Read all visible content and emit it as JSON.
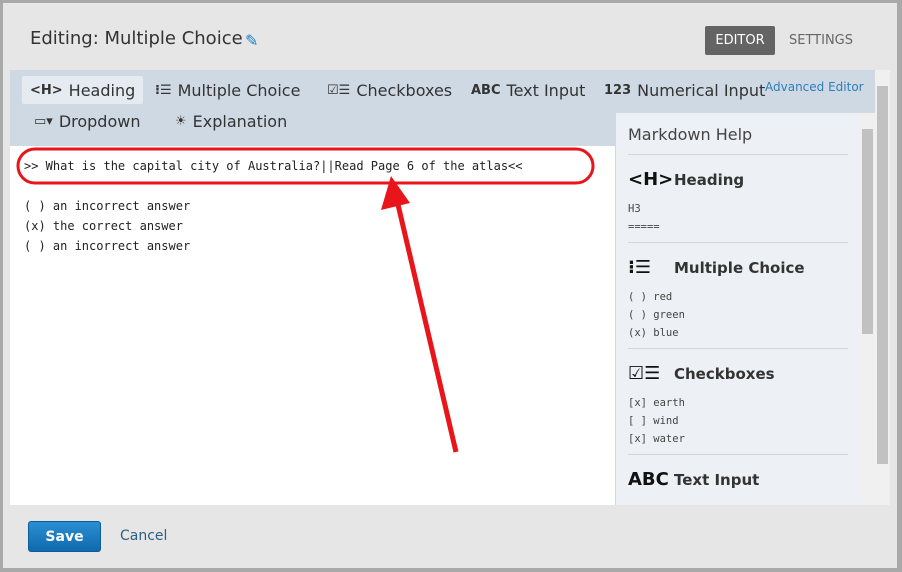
{
  "header": {
    "title": "Editing: Multiple Choice",
    "tabs": [
      {
        "label": "EDITOR",
        "active": true
      },
      {
        "label": "SETTINGS",
        "active": false
      }
    ]
  },
  "toolbar": {
    "items": [
      {
        "icon": "<H>",
        "label": "Heading"
      },
      {
        "icon": "multiple-choice-icon",
        "label": "Multiple Choice"
      },
      {
        "icon": "checkboxes-icon",
        "label": "Checkboxes"
      },
      {
        "icon": "ABC",
        "label": "Text Input"
      },
      {
        "icon": "123",
        "label": "Numerical Input"
      },
      {
        "icon": "dropdown-icon",
        "label": "Dropdown"
      },
      {
        "icon": "lightbulb-icon",
        "label": "Explanation"
      }
    ],
    "advanced_editor": "Advanced Editor"
  },
  "editor": {
    "lines": [
      ">> What is the capital city of Australia?||Read Page 6 of the atlas<<",
      "",
      "( ) an incorrect answer",
      "(x) the correct answer",
      "( ) an incorrect answer"
    ]
  },
  "help": {
    "title": "Markdown Help",
    "sections": [
      {
        "icon": "<H>",
        "title": "Heading",
        "example": "H3\n====="
      },
      {
        "icon": "multiple-choice-icon",
        "title": "Multiple Choice",
        "example": "( ) red\n( ) green\n(x) blue"
      },
      {
        "icon": "checkboxes-icon",
        "title": "Checkboxes",
        "example": "[x] earth\n[ ] wind\n[x] water"
      },
      {
        "icon": "ABC",
        "title": "Text Input",
        "example": ""
      }
    ]
  },
  "footer": {
    "save": "Save",
    "cancel": "Cancel"
  },
  "colors": {
    "accent": "#1a7ec8",
    "annotation": "#e8161b"
  }
}
